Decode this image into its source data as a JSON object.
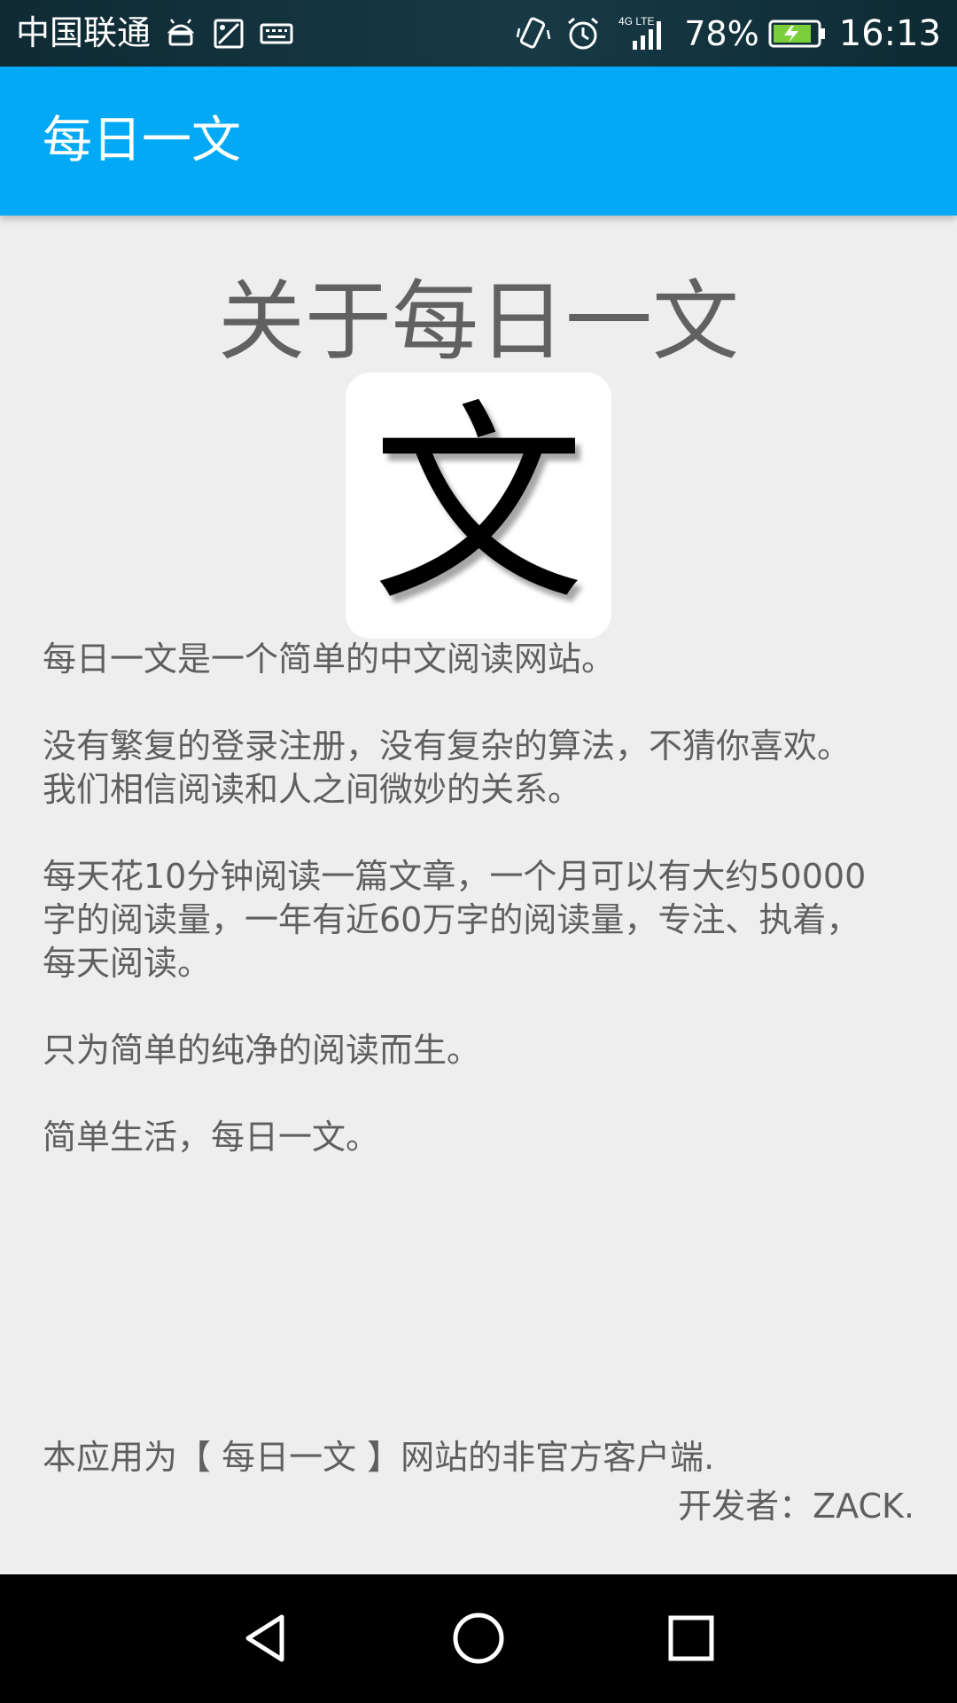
{
  "status_bar": {
    "carrier": "中国联通",
    "battery_percent": "78%",
    "time": "16:13",
    "network_label": "4G LTE",
    "left_icons": [
      "android-icon",
      "image-icon",
      "keyboard-icon"
    ],
    "right_icons": [
      "vibrate-icon",
      "alarm-icon",
      "signal-icon",
      "battery-charging-icon"
    ]
  },
  "app_bar": {
    "title": "每日一文",
    "color": "#03a9f4"
  },
  "content": {
    "heading": "关于每日一文",
    "logo_glyph": "文",
    "paragraphs": [
      "每日一文是一个简单的中文阅读网站。",
      "没有繁复的登录注册，没有复杂的算法，不猜你喜欢。我们相信阅读和人之间微妙的关系。",
      "每天花10分钟阅读一篇文章，一个月可以有大约50000字的阅读量，一年有近60万字的阅读量，专注、执着，每天阅读。",
      "只为简单的纯净的阅读而生。",
      "简单生活，每日一文。"
    ],
    "footer_note": "本应用为【 每日一文 】网站的非官方客户端.",
    "developer": "开发者：ZACK."
  },
  "nav_bar": {
    "buttons": [
      "back-icon",
      "home-icon",
      "recent-apps-icon"
    ]
  }
}
